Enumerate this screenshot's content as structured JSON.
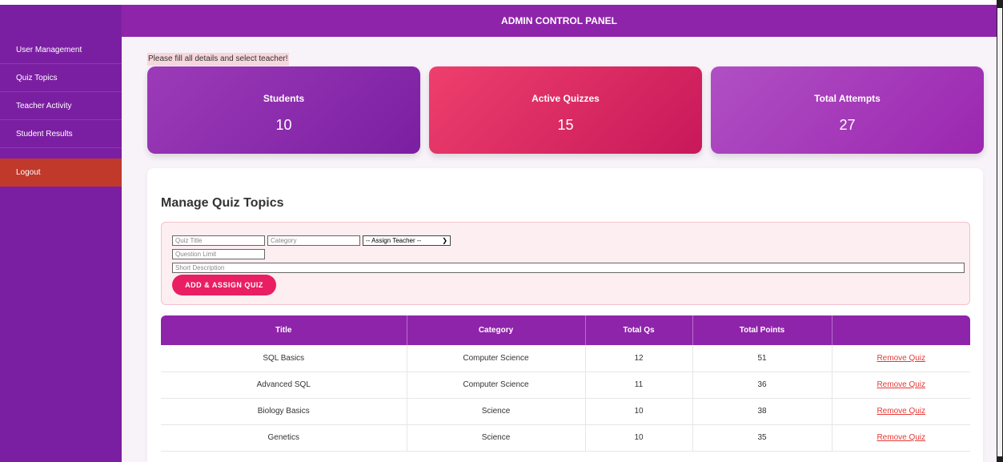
{
  "header": {
    "title": "ADMIN CONTROL PANEL"
  },
  "sidebar": {
    "items": [
      {
        "label": "User Management"
      },
      {
        "label": "Quiz Topics"
      },
      {
        "label": "Teacher Activity"
      },
      {
        "label": "Student Results"
      }
    ],
    "logout_label": "Logout"
  },
  "alert": {
    "text": "Please fill all details and select teacher!"
  },
  "stats": [
    {
      "title": "Students",
      "value": "10"
    },
    {
      "title": "Active Quizzes",
      "value": "15"
    },
    {
      "title": "Total Attempts",
      "value": "27"
    }
  ],
  "manage": {
    "heading": "Manage Quiz Topics",
    "title_placeholder": "Quiz Title",
    "category_placeholder": "Category",
    "teacher_select": "-- Assign Teacher --",
    "limit_placeholder": "Question Limit",
    "description_placeholder": "Short Description",
    "submit_label": "ADD & ASSIGN QUIZ"
  },
  "table": {
    "headers": [
      "Title",
      "Category",
      "Total Qs",
      "Total Points",
      ""
    ],
    "rows": [
      {
        "title": "SQL Basics",
        "category": "Computer Science",
        "total_qs": "12",
        "total_points": "51",
        "action": "Remove Quiz"
      },
      {
        "title": "Advanced SQL",
        "category": "Computer Science",
        "total_qs": "11",
        "total_points": "36",
        "action": "Remove Quiz"
      },
      {
        "title": "Biology Basics",
        "category": "Science",
        "total_qs": "10",
        "total_points": "38",
        "action": "Remove Quiz"
      },
      {
        "title": "Genetics",
        "category": "Science",
        "total_qs": "10",
        "total_points": "35",
        "action": "Remove Quiz"
      }
    ]
  },
  "colors": {
    "sidebar": "#7b1fa2",
    "header": "#8e24aa",
    "logout": "#c0392b",
    "accent": "#e91e63",
    "remove_link": "#e53935"
  }
}
